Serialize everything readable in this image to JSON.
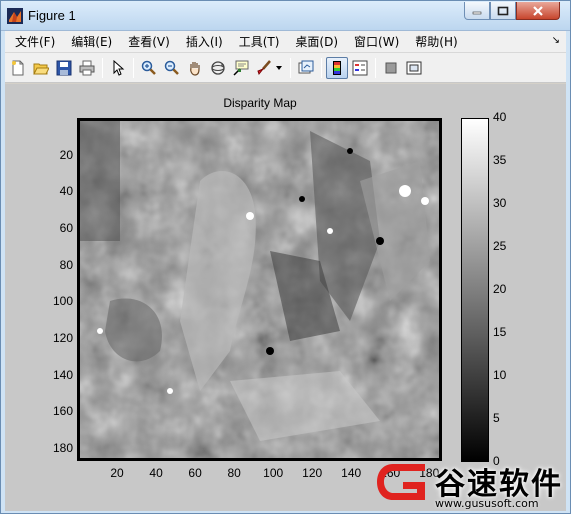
{
  "window": {
    "title": "Figure 1"
  },
  "menu": [
    "文件(F)",
    "编辑(E)",
    "查看(V)",
    "插入(I)",
    "工具(T)",
    "桌面(D)",
    "窗口(W)",
    "帮助(H)"
  ],
  "toolbar": {
    "icons": [
      "new-figure-icon",
      "open-file-icon",
      "save-icon",
      "print-icon",
      "pointer-icon",
      "zoom-in-icon",
      "zoom-out-icon",
      "pan-icon",
      "rotate-3d-icon",
      "data-cursor-icon",
      "brush-icon",
      "link-plot-icon",
      "colorbar-icon",
      "legend-icon",
      "hide-plot-tools-icon",
      "show-plot-tools-icon"
    ],
    "pressed": "colorbar-icon"
  },
  "chart_data": {
    "type": "heatmap",
    "title": "Disparity Map",
    "x_ticks": [
      "20",
      "40",
      "60",
      "80",
      "100",
      "120",
      "140",
      "160",
      "180"
    ],
    "y_ticks": [
      "20",
      "40",
      "60",
      "80",
      "100",
      "120",
      "140",
      "160",
      "180"
    ],
    "xlim": [
      1,
      185
    ],
    "ylim": [
      1,
      185
    ],
    "colormap": "gray",
    "colorbar": {
      "ticks": [
        "0",
        "5",
        "10",
        "15",
        "20",
        "25",
        "30",
        "35",
        "40"
      ],
      "range": [
        0,
        40
      ]
    }
  },
  "watermark": {
    "brand": "谷速软件",
    "url": "www.gususoft.com"
  },
  "colors": {
    "figure_bg": "#c8c8c8",
    "titlebar": "#bcd6ef",
    "watermark_red": "#e0231f"
  }
}
